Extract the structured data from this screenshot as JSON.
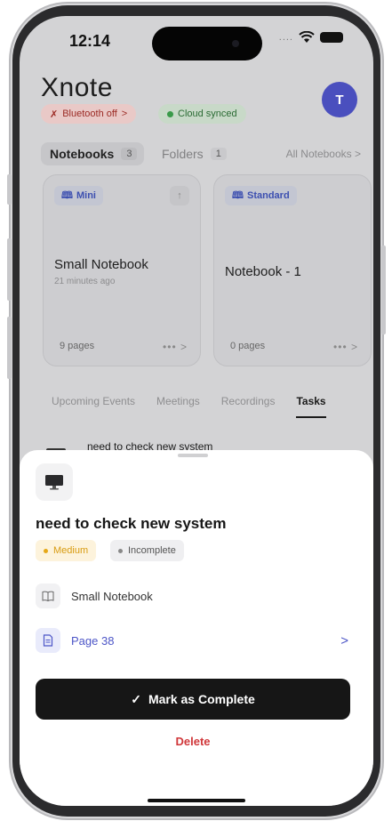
{
  "status_bar": {
    "time": "12:14",
    "signal": "....",
    "wifi_icon": "wifi-icon",
    "battery_icon": "battery-icon"
  },
  "header": {
    "app_name": "Xnote",
    "avatar_initial": "T",
    "bluetooth_label": "Bluetooth off",
    "bluetooth_arrow": ">",
    "cloud_label": "Cloud synced"
  },
  "segments": {
    "notebooks_label": "Notebooks",
    "notebooks_count": "3",
    "folders_label": "Folders",
    "folders_count": "1",
    "all_notebooks": "All Notebooks >"
  },
  "notebooks": [
    {
      "tag": "Mini",
      "title": "Small Notebook",
      "time": "21 minutes ago",
      "pages": "9 pages",
      "more": "•••  >"
    },
    {
      "tag": "Standard",
      "title": "Notebook - 1",
      "time": "",
      "pages": "0 pages",
      "more": "•••  >"
    }
  ],
  "tabs": [
    "Upcoming Events",
    "Meetings",
    "Recordings",
    "Tasks"
  ],
  "active_tab": "Tasks",
  "task_preview": {
    "title": "need to check new system"
  },
  "sheet": {
    "title": "need to check new system",
    "priority": "Medium",
    "status": "Incomplete",
    "notebook": "Small Notebook",
    "page": "Page 38",
    "page_chevron": ">",
    "complete_label": "Mark as Complete",
    "complete_check": "✓",
    "delete_label": "Delete"
  },
  "colors": {
    "accent": "#4c55c7",
    "avatar": "#4a4fbe",
    "danger": "#d0373a",
    "priority_medium": "#e6a817",
    "primary_button": "#161616"
  }
}
